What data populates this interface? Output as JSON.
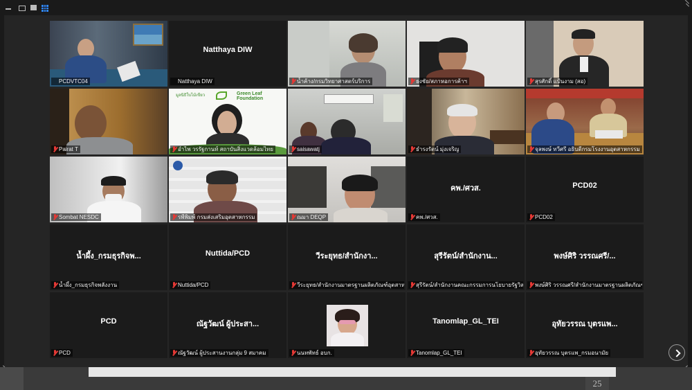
{
  "window": {
    "controls": [
      "minimize-icon",
      "restore-icon",
      "maximize-icon",
      "gallery-view-icon"
    ]
  },
  "tiles": [
    {
      "label": "PCDVTC04",
      "type": "video",
      "active": true
    },
    {
      "label": "Natthaya DIW",
      "name": "Natthaya DIW",
      "type": "name"
    },
    {
      "label": "น้ำค้าง/กรมวิทยาศาสตร์บริการ",
      "type": "video"
    },
    {
      "label": "ธงชัย/สภาหอการค้าฯ",
      "type": "video"
    },
    {
      "label": "สุรศักดิ์ แป้นงาม (สอ)",
      "type": "video"
    },
    {
      "label": "Pairat T",
      "type": "video"
    },
    {
      "label": "อำไพ วรรัฐกานท์ สถาบันสิ่งแวดล้อมไทย",
      "type": "video",
      "banner": "Green Leaf Foundation",
      "banner_left": "มูลนิธิใบไม้เขียว"
    },
    {
      "label": "saisawatj",
      "type": "video"
    },
    {
      "label": "ธำรงรัตน์ มุ่งเจริญ",
      "type": "video"
    },
    {
      "label": "จุลพงษ์ ทวีศรี อธิบดีกรมโรงงานอุตสาหกรรม",
      "type": "video"
    },
    {
      "label": "Sombat NESDC",
      "type": "video"
    },
    {
      "label": "รพีพิมพ์ กรมส่งเสริมอุตสาหกรรม",
      "type": "video"
    },
    {
      "label": "ณมา DEQP",
      "type": "video"
    },
    {
      "label": "คพ./ศวส.",
      "name": "คพ./ศวส.",
      "type": "name"
    },
    {
      "label": "PCD02",
      "name": "PCD02",
      "type": "name"
    },
    {
      "label": "น้ำผึ้ง_กรมธุรกิจพลังงาน",
      "name": "น้ำผึ้ง_กรมธุรกิจพ...",
      "type": "name"
    },
    {
      "label": "Nuttida/PCD",
      "name": "Nuttida/PCD",
      "type": "name"
    },
    {
      "label": "วีระยุทธ/สำนักงานมาตรฐานผลิตภัณฑ์อุตสาหกรรม",
      "name": "วีระยุทธ/สำนักงา...",
      "type": "name"
    },
    {
      "label": "สุรีรัตน์/สำนักงานคณะกรรมการนโยบายรัฐวิสาหกิจ",
      "name": "สุรีรัตน์/สำนักงาน...",
      "type": "name"
    },
    {
      "label": "พงษ์ศิริ วรรณศรี/สำนักงานมาตรฐานผลิตภัณฑ์อุตสาหกรรม",
      "name": "พงษ์ศิริ วรรณศรี/...",
      "type": "name"
    },
    {
      "label": "PCD",
      "name": "PCD",
      "type": "name"
    },
    {
      "label": "ณัฐวัฒน์ ผู้ประสานงานกลุ่ม 9 สมาคม",
      "name": "ณัฐวัฒน์ ผู้ประสา...",
      "type": "name"
    },
    {
      "label": "นนทพัทธ์ อบก.",
      "type": "photo"
    },
    {
      "label": "Tanomlap_GL_TEI",
      "name": "Tanomlap_GL_TEI",
      "type": "name"
    },
    {
      "label": "อุทัยวรรณ บุตรแพ_กรมอนามัย",
      "name": "อุทัยวรรณ บุตรแพ...",
      "type": "name"
    }
  ],
  "pager": {
    "next_icon": "chevron-right-icon"
  },
  "bottom": {
    "number": "25"
  },
  "colors": {
    "active_border": "#f2d600",
    "mute": "#e53935",
    "grid_icon": "#2f87ff"
  }
}
